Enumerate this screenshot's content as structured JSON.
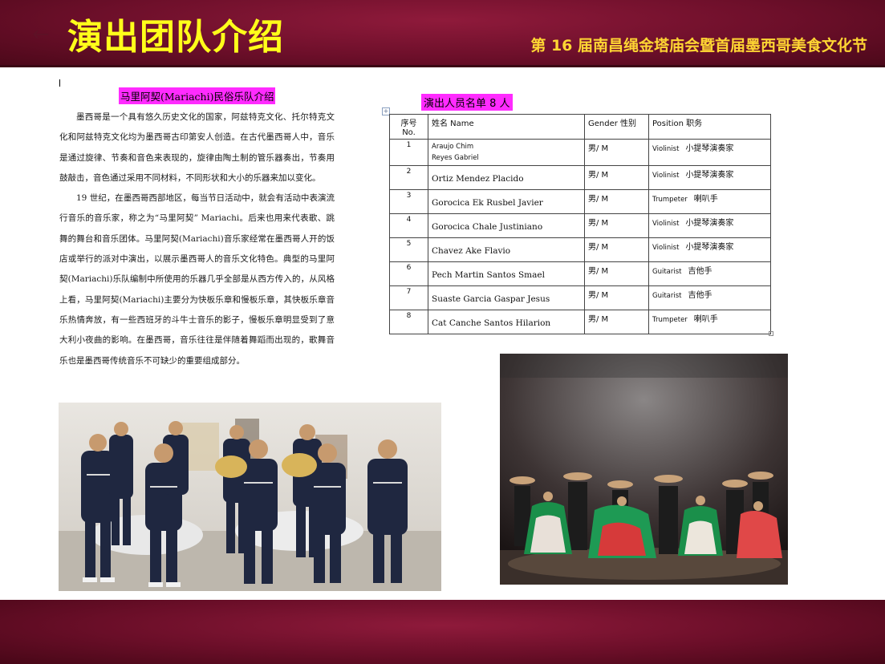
{
  "header": {
    "back_icon": "arrow-left-icon",
    "title": "演出团队介绍",
    "subtitle": "第 16 届南昌绳金塔庙会暨首届墨西哥美食文化节"
  },
  "intro": {
    "heading": "马里阿契(Mariachi)民俗乐队介绍",
    "paragraphs": [
      "墨西哥是一个具有悠久历史文化的国家，阿兹特克文化、托尔特克文化和阿兹特克文化均为墨西哥古印第安人创造。在古代墨西哥人中，音乐是通过旋律、节奏和音色来表现的，旋律由陶土制的管乐器奏出，节奏用鼓敲击，音色通过采用不同材料，不同形状和大小的乐器来加以变化。",
      "19 世纪，在墨西哥西部地区，每当节日活动中，就会有活动中表演流行音乐的音乐家，称之为“马里阿契” Mariachi。后来也用来代表歌、跳舞的舞台和音乐团体。马里阿契(Mariachi)音乐家经常在墨西哥人开的饭店或举行的派对中演出，以展示墨西哥人的音乐文化特色。典型的马里阿契(Mariachi)乐队编制中所使用的乐器几乎全部是从西方传入的，从风格上看，马里阿契(Mariachi)主要分为快板乐章和慢板乐章，其快板乐章音乐热情奔放，有一些西班牙的斗牛士音乐的影子，慢板乐章明显受到了意大利小夜曲的影响。在墨西哥，音乐往往是伴随着舞蹈而出现的，歌舞音乐也是墨西哥传统音乐不可缺少的重要组成部分。"
    ]
  },
  "roster": {
    "heading": "演出人员名单 8 人",
    "columns": {
      "no_line1": "序号",
      "no_line2": "No.",
      "name": "姓名    Name",
      "gender": "Gender 性别",
      "position": "Position 职务"
    },
    "rows": [
      {
        "no": "1",
        "name": "Araujo Chim",
        "name2": "Reyes Gabriel",
        "gender": "男/ M",
        "position_en": "Violinist",
        "position_zh": "小提琴演奏家"
      },
      {
        "no": "2",
        "name": "Ortiz    Mendez Placido",
        "gender": "男/ M",
        "position_en": "Violinist",
        "position_zh": "小提琴演奏家"
      },
      {
        "no": "3",
        "name": "Gorocica Ek Rusbel Javier",
        "gender": "男/ M",
        "position_en": "Trumpeter",
        "position_zh": "喇叭手"
      },
      {
        "no": "4",
        "name": "Gorocica Chale Justiniano",
        "gender": "男/ M",
        "position_en": "Violinist",
        "position_zh": "小提琴演奏家"
      },
      {
        "no": "5",
        "name": "Chavez Ake Flavio",
        "gender": "男/ M",
        "position_en": "Violinist",
        "position_zh": "小提琴演奏家"
      },
      {
        "no": "6",
        "name": "Pech Martin Santos Smael",
        "gender": "男/ M",
        "position_en": "Guitarist",
        "position_zh": "吉他手"
      },
      {
        "no": "7",
        "name": "Suaste Garcia Gaspar Jesus",
        "gender": "男/ M",
        "position_en": "Guitarist",
        "position_zh": "吉他手"
      },
      {
        "no": "8",
        "name": "Cat Canche Santos Hilarion",
        "gender": "男/ M",
        "position_en": "Trumpeter",
        "position_zh": "喇叭手"
      }
    ]
  },
  "colors": {
    "banner": "#6d0f2a",
    "title": "#ffff1a",
    "subtitle": "#ffd633",
    "highlight": "#ff2bff"
  }
}
